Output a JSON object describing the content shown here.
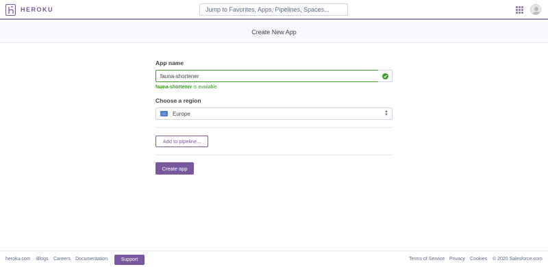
{
  "header": {
    "brand": "HEROKU",
    "search_placeholder": "Jump to Favorites, Apps, Pipelines, Spaces..."
  },
  "page": {
    "title": "Create New App"
  },
  "form": {
    "app_name_label": "App name",
    "app_name_value": "fauna-shortener",
    "availability_name": "fauna-shortener",
    "availability_suffix": " is available",
    "region_label": "Choose a region",
    "region_value": "Europe",
    "pipeline_button": "Add to pipeline...",
    "create_button": "Create app"
  },
  "footer": {
    "links": [
      "heroku.com",
      "Blogs",
      "Careers",
      "Documentation"
    ],
    "support_label": "Support",
    "right_links": [
      "Terms of Service",
      "Privacy",
      "Cookies"
    ],
    "copyright": "© 2020 Salesforce.com"
  },
  "colors": {
    "brand_purple": "#79589f",
    "success_green": "#3d9b26"
  }
}
